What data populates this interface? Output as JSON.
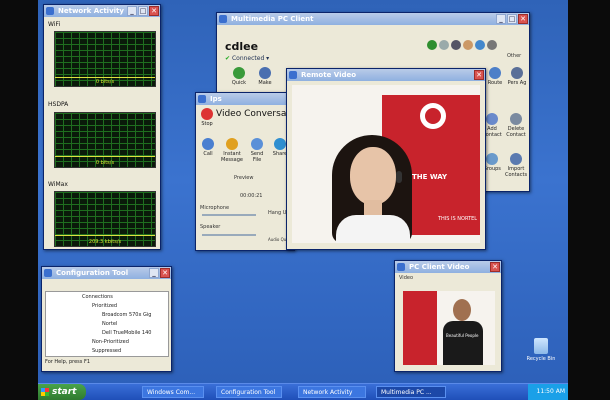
{
  "network_activity": {
    "title": "Network Activity",
    "graphs": [
      {
        "label": "WiFi",
        "value": "0 bits/s",
        "level": 0
      },
      {
        "label": "HSDPA",
        "value": "0 bits/s",
        "level": 0.05
      },
      {
        "label": "WiMax",
        "value": "209.3 kbits/s",
        "level": 0.08
      }
    ]
  },
  "pc_client": {
    "title": "Multimedia PC Client",
    "user": "cdlee",
    "status": "Connected",
    "buttons": [
      "Quick",
      "Make"
    ],
    "right_buttons": [
      "Route",
      "Pers Ag"
    ],
    "side_buttons": [
      "Add Contact",
      "Delete Contact",
      "Groups",
      "Import Contacts"
    ],
    "side_label": "Other"
  },
  "remote_video": {
    "title": "Remote Video",
    "banner_text_1": "THE WAY",
    "banner_text_2": "THIS IS NORTEL",
    "banner_text_3": "NORTEL"
  },
  "video_conversation": {
    "title": "Ips",
    "heading": "Video Conversation",
    "stop_label": "Stop",
    "buttons": [
      "Call",
      "Instant Message",
      "Send File",
      "Share"
    ],
    "preview": "Preview",
    "timer": "00:00:21",
    "microphone": "Microphone",
    "speaker": "Speaker",
    "hang_up": "Hang U",
    "audio": "Audio Qualit"
  },
  "config_tool": {
    "title": "Configuration Tool",
    "tree": [
      "Connections",
      "Prioritized",
      "Broadcom 570x Gig",
      "Nortel",
      "Dell TrueMobile 140",
      "Non-Prioritized",
      "Suppressed"
    ],
    "status": "For Help, press F1"
  },
  "pc_client_video": {
    "title": "PC Client Video",
    "label": "Video",
    "shirt_text": "Beautiful People"
  },
  "desktop": {
    "recycle_bin": "Recycle Bin"
  },
  "taskbar": {
    "start": "start",
    "tasks": [
      "Windows Com...",
      "Configuration Tool",
      "Network Activity",
      "Multimedia PC ..."
    ],
    "clock": "11:50 AM"
  }
}
